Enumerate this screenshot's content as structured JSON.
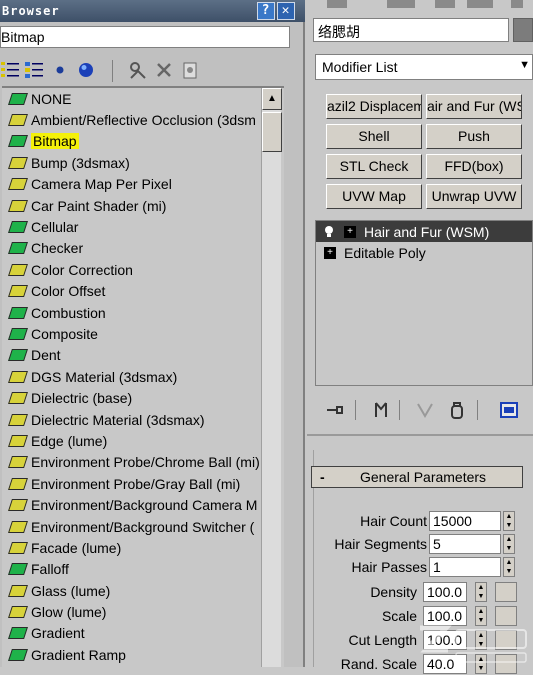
{
  "browser": {
    "title": "Browser",
    "help_label": "?",
    "close_label": "✕",
    "path": "Bitmap",
    "items": [
      {
        "label": "NONE",
        "color": "green"
      },
      {
        "label": "Ambient/Reflective Occlusion (3dsm",
        "color": "yellow"
      },
      {
        "label": "Bitmap",
        "color": "green",
        "selected": true
      },
      {
        "label": "Bump (3dsmax)",
        "color": "yellow"
      },
      {
        "label": "Camera Map Per Pixel",
        "color": "yellow"
      },
      {
        "label": "Car Paint Shader (mi)",
        "color": "yellow"
      },
      {
        "label": "Cellular",
        "color": "green"
      },
      {
        "label": "Checker",
        "color": "green"
      },
      {
        "label": "Color Correction",
        "color": "yellow"
      },
      {
        "label": "Color Offset",
        "color": "yellow"
      },
      {
        "label": "Combustion",
        "color": "green"
      },
      {
        "label": "Composite",
        "color": "green"
      },
      {
        "label": "Dent",
        "color": "green"
      },
      {
        "label": "DGS Material (3dsmax)",
        "color": "yellow"
      },
      {
        "label": "Dielectric (base)",
        "color": "yellow"
      },
      {
        "label": "Dielectric Material (3dsmax)",
        "color": "yellow"
      },
      {
        "label": "Edge (lume)",
        "color": "yellow"
      },
      {
        "label": "Environment Probe/Chrome Ball (mi)",
        "color": "yellow"
      },
      {
        "label": "Environment Probe/Gray Ball (mi)",
        "color": "yellow"
      },
      {
        "label": "Environment/Background Camera M",
        "color": "yellow"
      },
      {
        "label": "Environment/Background Switcher (",
        "color": "yellow"
      },
      {
        "label": "Facade (lume)",
        "color": "yellow"
      },
      {
        "label": "Falloff",
        "color": "green"
      },
      {
        "label": "Glass (lume)",
        "color": "yellow"
      },
      {
        "label": "Glow (lume)",
        "color": "yellow"
      },
      {
        "label": "Gradient",
        "color": "green"
      },
      {
        "label": "Gradient Ramp",
        "color": "green"
      }
    ]
  },
  "modify": {
    "object_name": "络腮胡",
    "modifier_list": "Modifier List",
    "buttons": [
      {
        "label": "azil2 Displacem"
      },
      {
        "label": "air and Fur (WS"
      },
      {
        "label": "Shell"
      },
      {
        "label": "Push"
      },
      {
        "label": "STL Check"
      },
      {
        "label": "FFD(box)"
      },
      {
        "label": "UVW Map"
      },
      {
        "label": "Unwrap UVW"
      }
    ],
    "stack": [
      {
        "label": "Hair and Fur (WSM)",
        "active": true
      },
      {
        "label": "Editable Poly",
        "active": false
      }
    ],
    "rollout": {
      "minus": "-",
      "title": "General Parameters",
      "params": [
        {
          "label": "Hair Count",
          "value": "15000"
        },
        {
          "label": "Hair Segments",
          "value": "5"
        },
        {
          "label": "Hair Passes",
          "value": "1"
        },
        {
          "label": "Density",
          "value": "100.0"
        },
        {
          "label": "Scale",
          "value": "100.0"
        },
        {
          "label": "Cut Length",
          "value": "100.0"
        },
        {
          "label": "Rand. Scale",
          "value": "40.0"
        }
      ]
    }
  },
  "colors": {
    "title_bar": "#4a5d75",
    "selected_highlight": "#f4f10a",
    "map_green": "#1fb24a",
    "map_yellow": "#d7d23a",
    "active_stack": "#3c3c3c"
  }
}
